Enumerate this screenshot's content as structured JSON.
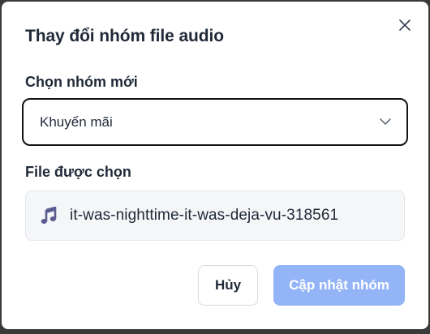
{
  "dialog": {
    "title": "Thay đổi nhóm file audio",
    "close_icon": "close-icon"
  },
  "group_select": {
    "label": "Chọn nhóm mới",
    "selected_value": "Khuyến mãi",
    "icon": "chevron-down-icon"
  },
  "selected_file": {
    "label": "File được chọn",
    "icon": "music-note-icon",
    "icon_color": "#5b5b8f",
    "name": "it-was-nighttime-it-was-deja-vu-318561"
  },
  "actions": {
    "cancel_label": "Hủy",
    "update_label": "Cập nhật nhóm",
    "update_color": "#93b4f7"
  }
}
